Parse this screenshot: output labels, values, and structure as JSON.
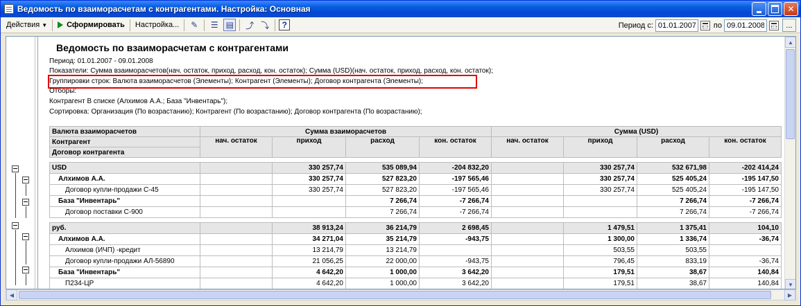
{
  "window": {
    "title": "Ведомость по взаиморасчетам с контрагентами. Настройка: Основная"
  },
  "toolbar": {
    "actions_label": "Действия",
    "generate_label": "Сформировать",
    "settings_label": "Настройка...",
    "period_from_label": "Период с:",
    "period_to_label": "по",
    "date_from": "01.01.2007",
    "date_to": "09.01.2008",
    "more_label": "..."
  },
  "report": {
    "title": "Ведомость по взаиморасчетам с контрагентами",
    "period": "Период: 01.01.2007 - 09.01.2008",
    "indicators": "Показатели: Сумма взаиморасчетов(нач. остаток, приход, расход, кон. остаток); Сумма (USD)(нач. остаток, приход, расход, кон. остаток);",
    "groupings": "Группировки строк: Валюта взаиморасчетов (Элементы); Контрагент (Элементы); Договор контрагента (Элементы);",
    "filters_label": "Отборы:",
    "filter_value": "Контрагент В списке (Алхимов А.А.; База \"Инвентарь\");",
    "sorting": "Сортировка: Организация (По возрастанию); Контрагент (По возрастанию); Договор контрагента (По возрастанию);"
  },
  "table": {
    "row_headers": [
      "Валюта взаиморасчетов",
      "Контрагент",
      "Договор контрагента"
    ],
    "group1_title": "Сумма взаиморасчетов",
    "group2_title": "Сумма (USD)",
    "columns": [
      "нач. остаток",
      "приход",
      "расход",
      "кон. остаток",
      "нач. остаток",
      "приход",
      "расход",
      "кон. остаток"
    ],
    "rows": [
      {
        "level": 1,
        "label": "USD",
        "v": [
          "",
          "330 257,74",
          "535 089,94",
          "-204 832,20",
          "",
          "330 257,74",
          "532 671,98",
          "-202 414,24"
        ]
      },
      {
        "level": 2,
        "label": "Алхимов А.А.",
        "v": [
          "",
          "330 257,74",
          "527 823,20",
          "-197 565,46",
          "",
          "330 257,74",
          "525 405,24",
          "-195 147,50"
        ]
      },
      {
        "level": 3,
        "label": "Договор купли-продажи С-45",
        "v": [
          "",
          "330 257,74",
          "527 823,20",
          "-197 565,46",
          "",
          "330 257,74",
          "525 405,24",
          "-195 147,50"
        ]
      },
      {
        "level": 2,
        "label": "База \"Инвентарь\"",
        "v": [
          "",
          "",
          "7 266,74",
          "-7 266,74",
          "",
          "",
          "7 266,74",
          "-7 266,74"
        ]
      },
      {
        "level": 3,
        "label": "Договор поставки С-900",
        "v": [
          "",
          "",
          "7 266,74",
          "-7 266,74",
          "",
          "",
          "7 266,74",
          "-7 266,74"
        ]
      },
      {
        "level": 1,
        "label": "руб.",
        "v": [
          "",
          "38 913,24",
          "36 214,79",
          "2 698,45",
          "",
          "1 479,51",
          "1 375,41",
          "104,10"
        ]
      },
      {
        "level": 2,
        "label": "Алхимов А.А.",
        "v": [
          "",
          "34 271,04",
          "35 214,79",
          "-943,75",
          "",
          "1 300,00",
          "1 336,74",
          "-36,74"
        ]
      },
      {
        "level": 3,
        "label": "Алхимов (ИЧП) -кредит",
        "v": [
          "",
          "13 214,79",
          "13 214,79",
          "",
          "",
          "503,55",
          "503,55",
          ""
        ]
      },
      {
        "level": 3,
        "label": "Договор купли-продажи АЛ-56890",
        "v": [
          "",
          "21 056,25",
          "22 000,00",
          "-943,75",
          "",
          "796,45",
          "833,19",
          "-36,74"
        ]
      },
      {
        "level": 2,
        "label": "База \"Инвентарь\"",
        "v": [
          "",
          "4 642,20",
          "1 000,00",
          "3 642,20",
          "",
          "179,51",
          "38,67",
          "140,84"
        ]
      },
      {
        "level": 3,
        "label": "П234-ЦР",
        "v": [
          "",
          "4 642,20",
          "1 000,00",
          "3 642,20",
          "",
          "179,51",
          "38,67",
          "140,84"
        ]
      }
    ]
  }
}
